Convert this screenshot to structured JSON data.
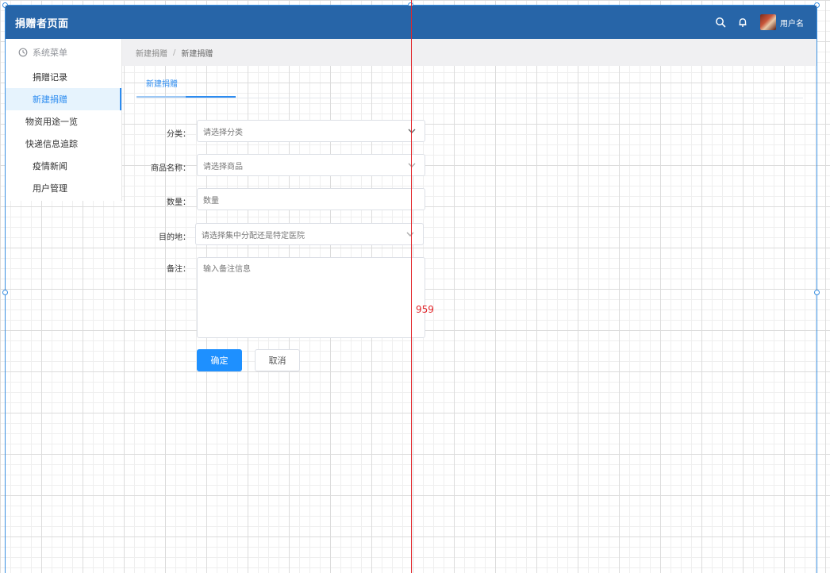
{
  "header": {
    "title": "捐赠者页面",
    "username": "用户名",
    "bg_color": "#2765a8",
    "icons": [
      "search-icon",
      "bell-icon"
    ]
  },
  "sidebar": {
    "header_label": "系统菜单",
    "items": [
      {
        "label": "捐赠记录",
        "active": false
      },
      {
        "label": "新建捐赠",
        "active": true
      },
      {
        "label": "物资用途一览",
        "active": false
      },
      {
        "label": "快递信息追踪",
        "active": false
      },
      {
        "label": "疫情新闻",
        "active": false
      },
      {
        "label": "用户管理",
        "active": false
      }
    ]
  },
  "breadcrumb": {
    "parent": "新建捐赠",
    "separator": "/",
    "current": "新建捐赠"
  },
  "tabs": [
    {
      "label": "新建捐赠",
      "active": true
    }
  ],
  "form": {
    "category": {
      "label": "分类：",
      "placeholder": "请选择分类"
    },
    "product": {
      "label": "商品名称：",
      "placeholder": "请选择商品"
    },
    "quantity": {
      "label": "数量：",
      "placeholder": "数量"
    },
    "destination": {
      "label": "目的地：",
      "placeholder": "请选择集中分配还是特定医院"
    },
    "notes": {
      "label": "备注：",
      "placeholder": "输入备注信息"
    },
    "confirm_label": "确定",
    "cancel_label": "取消"
  },
  "guide": {
    "label": "959",
    "color": "#e2262a"
  },
  "accent_color": "#2d8cf0"
}
